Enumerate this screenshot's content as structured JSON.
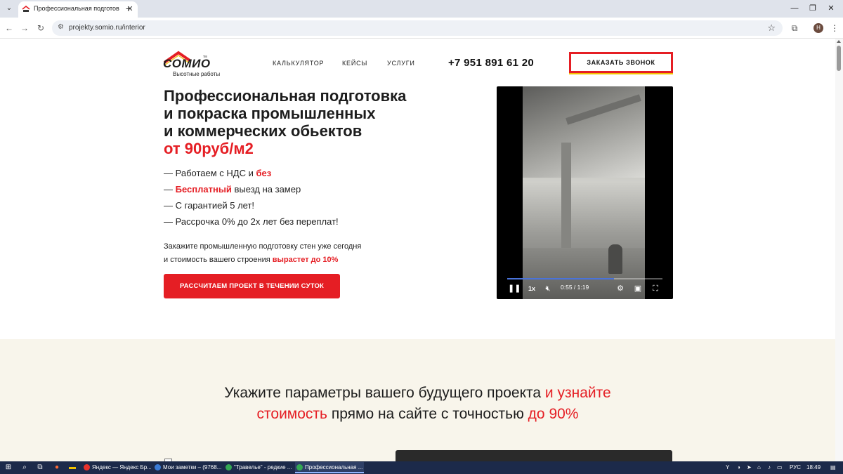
{
  "browser": {
    "tab_title": "Профессиональная подготов",
    "new_tab": "+",
    "url": "projekty.somio.ru/interior",
    "profile_initial": "Н"
  },
  "header": {
    "logo_text": "СОМИО",
    "logo_tm": "тм",
    "logo_sub": "Высотные работы",
    "nav": [
      "КАЛЬКУЛЯТОР",
      "КЕЙСЫ",
      "УСЛУГИ"
    ],
    "phone": "+7 951 891 61 20",
    "callback_label": "ЗАКАЗАТЬ ЗВОНОК"
  },
  "hero": {
    "title_lines": [
      "Профессиональная подготовка",
      "и покраска промышленных",
      "и коммерческих обьектов"
    ],
    "price": "от 90руб/м2",
    "bullets": [
      {
        "pre": "— Работаем с НДС и ",
        "bold": "без",
        "post": ""
      },
      {
        "pre": "— ",
        "bold": "Бесплатный",
        "post": " выезд на замер"
      },
      {
        "pre": "— С гарантией 5 лет!",
        "bold": "",
        "post": ""
      },
      {
        "pre": "— Рассрочка 0% до 2х лет без переплат!",
        "bold": "",
        "post": ""
      }
    ],
    "desc_line1": "Закажите промышленную подготовку стен уже сегодня",
    "desc_line2_pre": "и стоимость вашего строения ",
    "desc_line2_red": "вырастет до 10%",
    "cta_label": "РАССЧИТАЕМ ПРОЕКТ В ТЕЧЕНИИ СУТОК"
  },
  "video": {
    "speed": "1x",
    "time": "0:55 / 1:19",
    "progress": 0.69
  },
  "section2": {
    "line1_dark": "Укажите параметры вашего будущего проекта ",
    "line1_red": "и узнайте",
    "line2_red1": "стоимость",
    "line2_dark": " прямо на сайте с точностью ",
    "line2_red2": "до 90%"
  },
  "taskbar": {
    "apps": [
      {
        "label": "Яндекс — Яндекс Бр...",
        "color": "#e8312b"
      },
      {
        "label": "Мои заметки – (9768...",
        "color": "#3a7bd5"
      },
      {
        "label": "\"Травелье\" - редкие ...",
        "color": "#34a853"
      },
      {
        "label": "Профессиональная ...",
        "color": "#34a853"
      }
    ],
    "lang": "РУС",
    "time": "18:49"
  },
  "colors": {
    "accent": "#e51e24",
    "section_bg": "#f8f5eb"
  }
}
